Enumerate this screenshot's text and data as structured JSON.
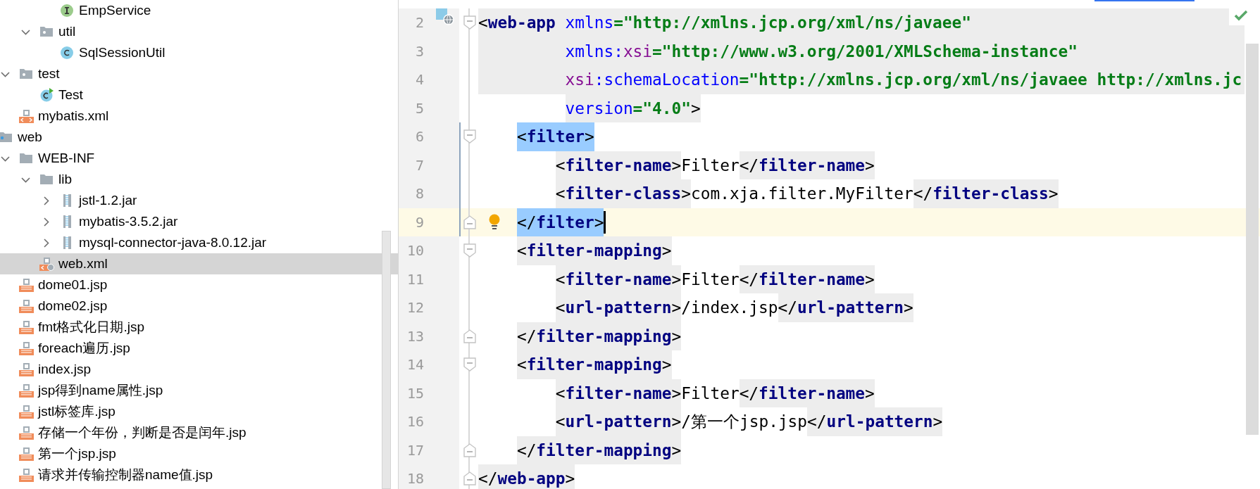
{
  "project_tree": {
    "items": [
      {
        "children": [
          {
            "children": [
              {
                "children": [
                  {
                    "label": "EmpService",
                    "kind": "interface",
                    "selected": false
                  }
                ]
              },
              {
                "label": "util",
                "kind": "package",
                "expanded": true,
                "selected": false,
                "children": [
                  {
                    "label": "SqlSessionUtil",
                    "kind": "class",
                    "selected": false
                  }
                ]
              }
            ]
          },
          {
            "label": "test",
            "kind": "package",
            "expanded": true,
            "selected": false,
            "children": [
              {
                "label": "Test",
                "kind": "test",
                "selected": false
              }
            ]
          },
          {
            "label": "mybatis.xml",
            "kind": "xml",
            "selected": false
          }
        ]
      },
      {
        "label": "web",
        "kind": "webroot",
        "selected": false,
        "children": [
          {
            "label": "WEB-INF",
            "kind": "folder",
            "expanded": true,
            "selected": false,
            "children": [
              {
                "label": "lib",
                "kind": "folder",
                "expanded": true,
                "selected": false,
                "children": [
                  {
                    "label": "jstl-1.2.jar",
                    "kind": "jar",
                    "expanded": false,
                    "selected": false
                  },
                  {
                    "label": "mybatis-3.5.2.jar",
                    "kind": "jar",
                    "expanded": false,
                    "selected": false
                  },
                  {
                    "label": "mysql-connector-java-8.0.12.jar",
                    "kind": "jar",
                    "expanded": false,
                    "selected": false
                  }
                ]
              },
              {
                "label": "web.xml",
                "kind": "descriptor",
                "selected": true
              }
            ]
          },
          {
            "label": "dome01.jsp",
            "kind": "jsp",
            "selected": false
          },
          {
            "label": "dome02.jsp",
            "kind": "jsp",
            "selected": false
          },
          {
            "label": "fmt格式化日期.jsp",
            "kind": "jsp",
            "selected": false
          },
          {
            "label": "foreach遍历.jsp",
            "kind": "jsp",
            "selected": false
          },
          {
            "label": "index.jsp",
            "kind": "jsp",
            "selected": false
          },
          {
            "label": "jsp得到name属性.jsp",
            "kind": "jsp",
            "selected": false
          },
          {
            "label": "jstl标签库.jsp",
            "kind": "jsp",
            "selected": false
          },
          {
            "label": "存储一个年份，判断是否是闰年.jsp",
            "kind": "jsp",
            "selected": false
          },
          {
            "label": "第一个jsp.jsp",
            "kind": "jsp",
            "selected": false
          },
          {
            "label": "请求并传输控制器name值.jsp",
            "kind": "jsp",
            "selected": false
          }
        ]
      }
    ]
  },
  "editor": {
    "lines": [
      {
        "number": "2",
        "fold_start": true,
        "fold_end": false,
        "shaded": true,
        "current": false,
        "in_scope": false,
        "caret": false,
        "tokens": [
          {
            "text": "<",
            "kind": "punct"
          },
          {
            "text": "web-app",
            "kind": "tag"
          },
          {
            "text": " xmlns",
            "kind": "attr"
          },
          {
            "text": "=\"http://xmlns.jcp.org/xml/ns/javaee\"",
            "kind": "value"
          }
        ]
      },
      {
        "number": "3",
        "fold_start": false,
        "fold_end": false,
        "shaded": true,
        "current": false,
        "in_scope": false,
        "caret": false,
        "tokens": [
          {
            "text": "         xmlns:",
            "kind": "attr"
          },
          {
            "text": "xsi",
            "kind": "prefix"
          },
          {
            "text": "=\"http://www.w3.org/2001/XMLSchema-instance\"",
            "kind": "value"
          }
        ]
      },
      {
        "number": "4",
        "fold_start": false,
        "fold_end": false,
        "shaded": true,
        "current": false,
        "in_scope": false,
        "caret": false,
        "tokens": [
          {
            "text": "         xsi",
            "kind": "prefix"
          },
          {
            "text": ":schemaLocation",
            "kind": "attr"
          },
          {
            "text": "=\"http://xmlns.jcp.org/xml/ns/javaee http://xmlns.jc",
            "kind": "value"
          }
        ]
      },
      {
        "number": "5",
        "fold_start": false,
        "fold_end": false,
        "shaded": false,
        "current": false,
        "in_scope": false,
        "caret": false,
        "tokens": [
          {
            "text": "         version",
            "kind": "attr",
            "shaded": true
          },
          {
            "text": "=\"4.0\"",
            "kind": "value",
            "shaded": true
          },
          {
            "text": ">",
            "kind": "punct",
            "shaded": true
          }
        ]
      },
      {
        "number": "6",
        "fold_start": true,
        "fold_end": false,
        "shaded": false,
        "current": false,
        "in_scope": true,
        "caret": false,
        "tokens": [
          {
            "text": "    <",
            "kind": "punct",
            "matched": true
          },
          {
            "text": "filter",
            "kind": "tag",
            "matched": true
          },
          {
            "text": ">",
            "kind": "punct",
            "matched": true
          }
        ]
      },
      {
        "number": "7",
        "fold_start": false,
        "fold_end": false,
        "shaded": false,
        "current": false,
        "in_scope": true,
        "caret": false,
        "tokens": [
          {
            "text": "        <",
            "kind": "punct",
            "shaded": true
          },
          {
            "text": "filter-name",
            "kind": "tag",
            "shaded": true
          },
          {
            "text": ">",
            "kind": "punct",
            "shaded": true
          },
          {
            "text": "Filter",
            "kind": "text",
            "shaded": false
          },
          {
            "text": "</",
            "kind": "punct",
            "shaded": true
          },
          {
            "text": "filter-name",
            "kind": "tag",
            "shaded": true
          },
          {
            "text": ">",
            "kind": "punct",
            "shaded": true
          }
        ]
      },
      {
        "number": "8",
        "fold_start": false,
        "fold_end": false,
        "shaded": false,
        "current": false,
        "in_scope": true,
        "caret": false,
        "tokens": [
          {
            "text": "        <",
            "kind": "punct",
            "shaded": true
          },
          {
            "text": "filter-class",
            "kind": "tag",
            "shaded": true
          },
          {
            "text": ">",
            "kind": "punct",
            "shaded": true
          },
          {
            "text": "com.xja.filter.MyFilter",
            "kind": "text",
            "shaded": false
          },
          {
            "text": "</",
            "kind": "punct",
            "shaded": true
          },
          {
            "text": "filter-class",
            "kind": "tag",
            "shaded": true
          },
          {
            "text": ">",
            "kind": "punct",
            "shaded": true
          }
        ]
      },
      {
        "number": "9",
        "fold_start": false,
        "fold_end": true,
        "shaded": false,
        "current": true,
        "in_scope": true,
        "caret": true,
        "tokens": [
          {
            "text": "    </",
            "kind": "punct",
            "matched": true
          },
          {
            "text": "filter",
            "kind": "tag",
            "matched": true
          },
          {
            "text": ">",
            "kind": "punct",
            "matched": true
          }
        ]
      },
      {
        "number": "10",
        "fold_start": true,
        "fold_end": false,
        "shaded": false,
        "current": false,
        "in_scope": false,
        "caret": false,
        "tokens": [
          {
            "text": "    <",
            "kind": "punct",
            "shaded": true
          },
          {
            "text": "filter-mapping",
            "kind": "tag",
            "shaded": true
          },
          {
            "text": ">",
            "kind": "punct",
            "shaded": true
          }
        ]
      },
      {
        "number": "11",
        "fold_start": false,
        "fold_end": false,
        "shaded": false,
        "current": false,
        "in_scope": false,
        "caret": false,
        "tokens": [
          {
            "text": "        <",
            "kind": "punct",
            "shaded": true
          },
          {
            "text": "filter-name",
            "kind": "tag",
            "shaded": true
          },
          {
            "text": ">",
            "kind": "punct",
            "shaded": true
          },
          {
            "text": "Filter",
            "kind": "text",
            "shaded": false
          },
          {
            "text": "</",
            "kind": "punct",
            "shaded": true
          },
          {
            "text": "filter-name",
            "kind": "tag",
            "shaded": true
          },
          {
            "text": ">",
            "kind": "punct",
            "shaded": true
          }
        ]
      },
      {
        "number": "12",
        "fold_start": false,
        "fold_end": false,
        "shaded": false,
        "current": false,
        "in_scope": false,
        "caret": false,
        "tokens": [
          {
            "text": "        <",
            "kind": "punct",
            "shaded": true
          },
          {
            "text": "url-pattern",
            "kind": "tag",
            "shaded": true
          },
          {
            "text": ">",
            "kind": "punct",
            "shaded": true
          },
          {
            "text": "/index.jsp",
            "kind": "text",
            "shaded": false
          },
          {
            "text": "</",
            "kind": "punct",
            "shaded": true
          },
          {
            "text": "url-pattern",
            "kind": "tag",
            "shaded": true
          },
          {
            "text": ">",
            "kind": "punct",
            "shaded": true
          }
        ]
      },
      {
        "number": "13",
        "fold_start": false,
        "fold_end": true,
        "shaded": false,
        "current": false,
        "in_scope": false,
        "caret": false,
        "tokens": [
          {
            "text": "    </",
            "kind": "punct",
            "shaded": true
          },
          {
            "text": "filter-mapping",
            "kind": "tag",
            "shaded": true
          },
          {
            "text": ">",
            "kind": "punct",
            "shaded": true
          }
        ]
      },
      {
        "number": "14",
        "fold_start": true,
        "fold_end": false,
        "shaded": false,
        "current": false,
        "in_scope": false,
        "caret": false,
        "tokens": [
          {
            "text": "    <",
            "kind": "punct",
            "shaded": true
          },
          {
            "text": "filter-mapping",
            "kind": "tag",
            "shaded": true
          },
          {
            "text": ">",
            "kind": "punct",
            "shaded": true
          }
        ]
      },
      {
        "number": "15",
        "fold_start": false,
        "fold_end": false,
        "shaded": false,
        "current": false,
        "in_scope": false,
        "caret": false,
        "tokens": [
          {
            "text": "        <",
            "kind": "punct",
            "shaded": true
          },
          {
            "text": "filter-name",
            "kind": "tag",
            "shaded": true
          },
          {
            "text": ">",
            "kind": "punct",
            "shaded": true
          },
          {
            "text": "Filter",
            "kind": "text",
            "shaded": false
          },
          {
            "text": "</",
            "kind": "punct",
            "shaded": true
          },
          {
            "text": "filter-name",
            "kind": "tag",
            "shaded": true
          },
          {
            "text": ">",
            "kind": "punct",
            "shaded": true
          }
        ]
      },
      {
        "number": "16",
        "fold_start": false,
        "fold_end": false,
        "shaded": false,
        "current": false,
        "in_scope": false,
        "caret": false,
        "tokens": [
          {
            "text": "        <",
            "kind": "punct",
            "shaded": true
          },
          {
            "text": "url-pattern",
            "kind": "tag",
            "shaded": true
          },
          {
            "text": ">",
            "kind": "punct",
            "shaded": true
          },
          {
            "text": "/第一个jsp.jsp",
            "kind": "text",
            "shaded": false
          },
          {
            "text": "</",
            "kind": "punct",
            "shaded": true
          },
          {
            "text": "url-pattern",
            "kind": "tag",
            "shaded": true
          },
          {
            "text": ">",
            "kind": "punct",
            "shaded": true
          }
        ]
      },
      {
        "number": "17",
        "fold_start": false,
        "fold_end": true,
        "shaded": false,
        "current": false,
        "in_scope": false,
        "caret": false,
        "tokens": [
          {
            "text": "    </",
            "kind": "punct",
            "shaded": true
          },
          {
            "text": "filter-mapping",
            "kind": "tag",
            "shaded": true
          },
          {
            "text": ">",
            "kind": "punct",
            "shaded": true
          }
        ]
      },
      {
        "number": "18",
        "fold_start": false,
        "fold_end": true,
        "shaded": false,
        "current": false,
        "in_scope": false,
        "caret": false,
        "tokens": [
          {
            "text": "</",
            "kind": "punct",
            "shaded": true
          },
          {
            "text": "web-app",
            "kind": "tag",
            "shaded": true
          },
          {
            "text": ">",
            "kind": "punct",
            "shaded": true
          }
        ]
      }
    ]
  }
}
